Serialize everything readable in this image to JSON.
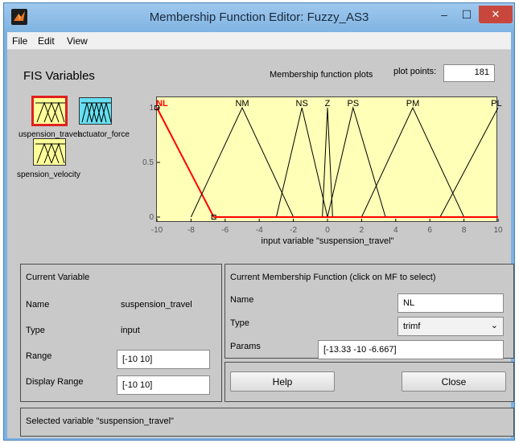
{
  "window": {
    "title": "Membership Function Editor: Fuzzy_AS3",
    "minimize_glyph": "–",
    "maximize_glyph": "☐",
    "close_glyph": "✕"
  },
  "menu": {
    "file": "File",
    "edit": "Edit",
    "view": "View"
  },
  "fis": {
    "header": "FIS Variables",
    "variables": [
      {
        "label": "uspension_travel",
        "color": "#ffff99",
        "selected": true
      },
      {
        "label": "actuator_force",
        "color": "#66e0f2",
        "selected": false
      },
      {
        "label": "spension_velocity",
        "color": "#ffff99",
        "selected": false
      }
    ],
    "var1_label_visible": "uspension_travel",
    "var2_label_visible": "actuator_force",
    "var3_label_visible": "spension_velocity"
  },
  "plot": {
    "header": "Membership function plots",
    "points_label": "plot points:",
    "points_value": "181",
    "xlabel": "input variable \"suspension_travel\"",
    "selected_color": "#ff0000",
    "line_color": "#000000"
  },
  "chart_data": {
    "type": "line",
    "title": "",
    "xlabel": "input variable \"suspension_travel\"",
    "ylabel": "",
    "xlim": [
      -10,
      10
    ],
    "ylim": [
      0,
      1
    ],
    "x_ticks": [
      "-10",
      "-8",
      "-6",
      "-4",
      "-2",
      "0",
      "2",
      "4",
      "6",
      "8",
      "10"
    ],
    "y_ticks": [
      "0",
      "0.5",
      "1"
    ],
    "series": [
      {
        "name": "NL",
        "params": [
          -13.33,
          -10,
          -6.667
        ]
      },
      {
        "name": "NM",
        "params": [
          -8,
          -5,
          -2
        ]
      },
      {
        "name": "NS",
        "params": [
          -3,
          -1.5,
          0
        ]
      },
      {
        "name": "Z",
        "params": [
          -0.3,
          0,
          0.3
        ]
      },
      {
        "name": "PS",
        "params": [
          0,
          1.5,
          3.4
        ]
      },
      {
        "name": "PM",
        "params": [
          2,
          5,
          8
        ]
      },
      {
        "name": "PL",
        "params": [
          6.6,
          10,
          13.4
        ]
      }
    ]
  },
  "current_variable": {
    "header": "Current Variable",
    "name_label": "Name",
    "name_value": "suspension_travel",
    "type_label": "Type",
    "type_value": "input",
    "range_label": "Range",
    "range_value": "[-10 10]",
    "display_range_label": "Display Range",
    "display_range_value": "[-10 10]"
  },
  "current_mf": {
    "header": "Current Membership Function (click on MF to select)",
    "name_label": "Name",
    "name_value": "NL",
    "type_label": "Type",
    "type_value": "trimf",
    "params_label": "Params",
    "params_value": "[-13.33 -10 -6.667]"
  },
  "buttons": {
    "help": "Help",
    "close": "Close"
  },
  "status": {
    "text": "Selected variable \"suspension_travel\""
  }
}
